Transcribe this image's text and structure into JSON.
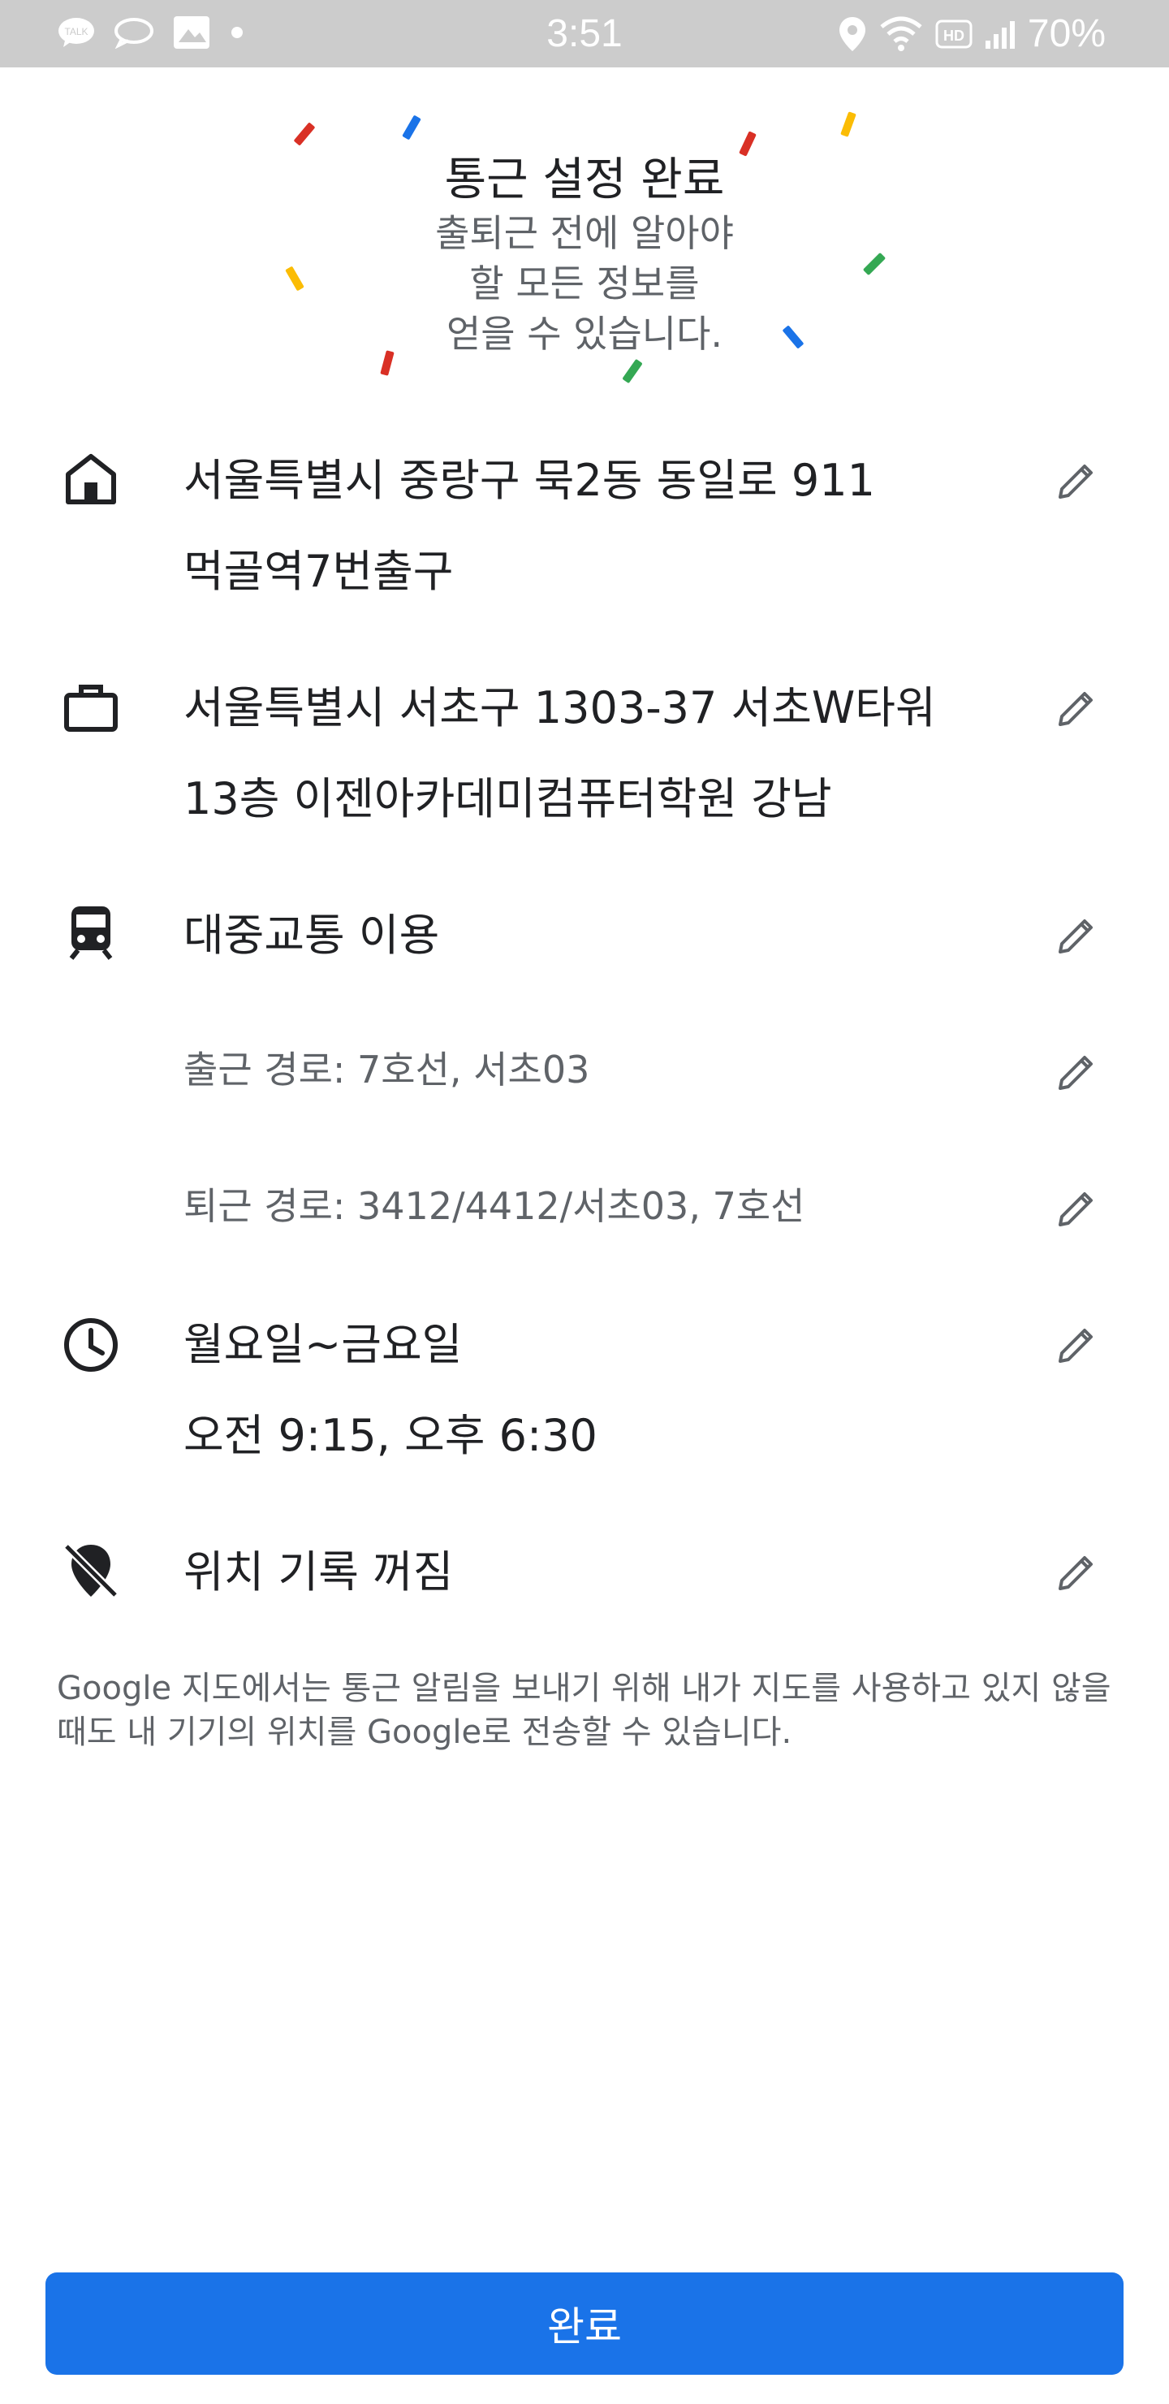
{
  "status_bar": {
    "time": "3:51",
    "battery": "70%",
    "left_icons": [
      "talk-icon",
      "chat-bubble-icon",
      "image-icon",
      "dot-icon"
    ],
    "right_icons": [
      "location-icon",
      "wifi-icon",
      "hd-icon",
      "signal-icon"
    ]
  },
  "header": {
    "title": "통근 설정 완료",
    "subtitle_lines": [
      "출퇴근 전에 알아야",
      "할 모든 정보를",
      "얻을 수 있습니다."
    ]
  },
  "items": {
    "home": {
      "icon": "home-icon",
      "line1": "서울특별시 중랑구 묵2동 동일로 911",
      "line2": "먹골역7번출구"
    },
    "work": {
      "icon": "briefcase-icon",
      "line1": "서울특별시 서초구 1303-37 서초W타워",
      "line2": "13층 이젠아카데미컴퓨터학원 강남"
    },
    "transit": {
      "icon": "train-icon",
      "label": "대중교통 이용",
      "to_work": "출근 경로: 7호선, 서초03",
      "to_home": "퇴근 경로: 3412/4412/서초03, 7호선"
    },
    "schedule": {
      "icon": "clock-icon",
      "days": "월요일~금요일",
      "times": "오전 9:15, 오후 6:30"
    },
    "location_history": {
      "icon": "location-off-icon",
      "label": "위치 기록 꺼짐"
    }
  },
  "note": "Google 지도에서는 통근 알림을 보내기 위해 내가 지도를 사용하고 있지 않을 때도 내 기기의 위치를 Google로 전송할 수 있습니다.",
  "done_button": "완료",
  "colors": {
    "accent": "#1a73e8",
    "confetti": [
      "#d93025",
      "#1a73e8",
      "#fbbc04",
      "#34a853"
    ]
  }
}
